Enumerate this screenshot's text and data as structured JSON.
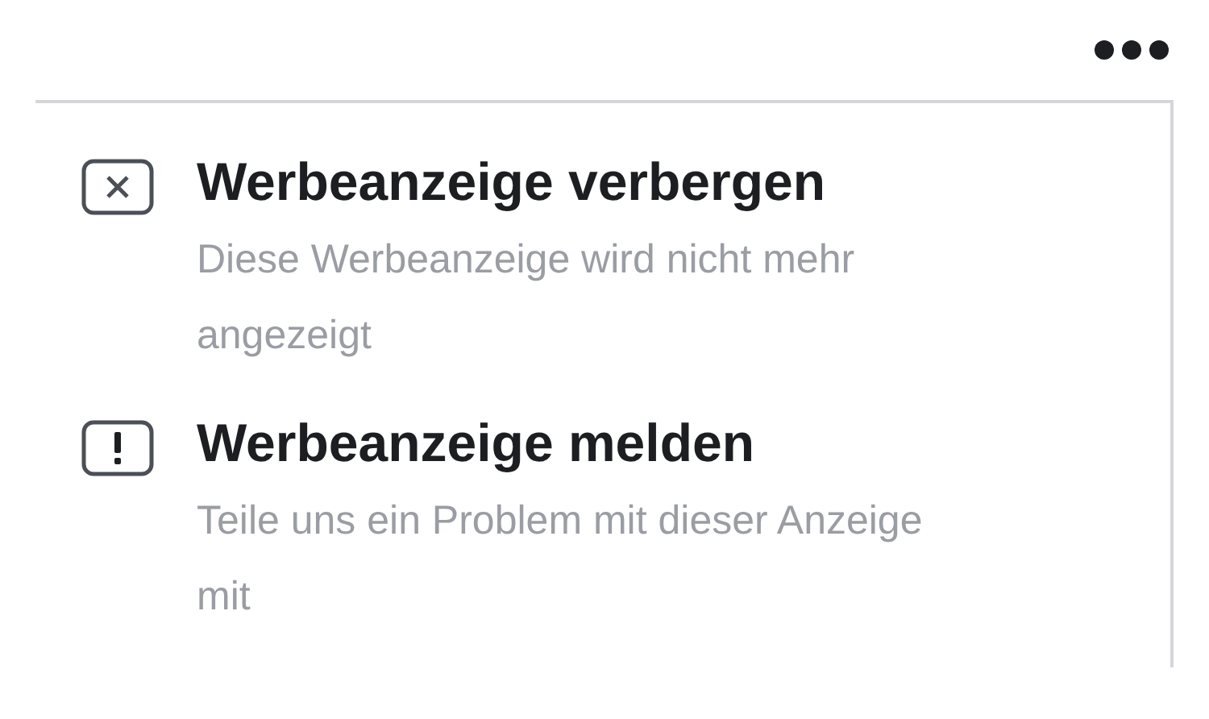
{
  "menu": {
    "items": [
      {
        "kind": "hide",
        "title": "Werbeanzeige verbergen",
        "description": "Diese Werbeanzeige wird nicht mehr angezeigt"
      },
      {
        "kind": "report",
        "title": "Werbeanzeige melden",
        "description": "Teile uns ein Problem mit dieser Anzeige mit"
      }
    ]
  }
}
